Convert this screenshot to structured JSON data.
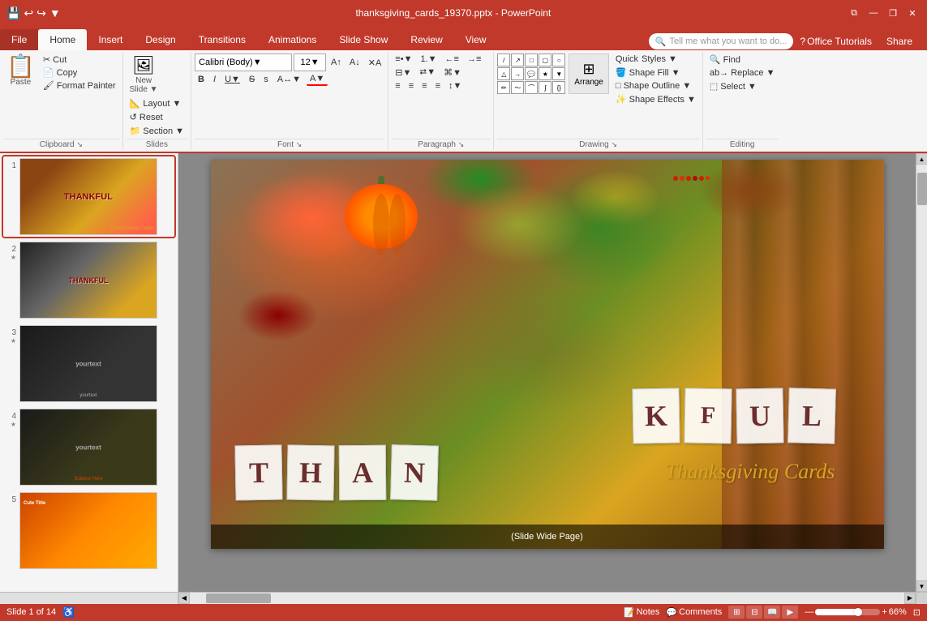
{
  "titlebar": {
    "title": "thanksgiving_cards_19370.pptx - PowerPoint",
    "save_icon": "💾",
    "undo_icon": "↩",
    "redo_icon": "↪",
    "customize_icon": "⚙",
    "minimize": "—",
    "restore": "❐",
    "close": "✕"
  },
  "tabs": [
    {
      "label": "File",
      "id": "file"
    },
    {
      "label": "Home",
      "id": "home",
      "active": true
    },
    {
      "label": "Insert",
      "id": "insert"
    },
    {
      "label": "Design",
      "id": "design"
    },
    {
      "label": "Transitions",
      "id": "transitions"
    },
    {
      "label": "Animations",
      "id": "animations"
    },
    {
      "label": "Slide Show",
      "id": "slideshow"
    },
    {
      "label": "Review",
      "id": "review"
    },
    {
      "label": "View",
      "id": "view"
    }
  ],
  "ribbon": {
    "search_placeholder": "Tell me what you want to do...",
    "groups": {
      "clipboard": {
        "label": "Clipboard",
        "paste": "Paste",
        "cut": "Cut",
        "copy": "Copy",
        "format_painter": "Format Painter"
      },
      "slides": {
        "label": "Slides",
        "new_slide": "New Slide",
        "layout": "Layout",
        "reset": "Reset",
        "section": "Section"
      },
      "font": {
        "label": "Font",
        "name": "Calibri (Body)",
        "size": "12",
        "bold": "B",
        "italic": "I",
        "underline": "U",
        "strikethrough": "S",
        "shadow": "s",
        "char_spacing": "A",
        "font_color": "A"
      },
      "paragraph": {
        "label": "Paragraph"
      },
      "drawing": {
        "label": "Drawing",
        "arrange": "Arrange",
        "quick_styles": "Quick Styles",
        "shape_fill": "Shape Fill",
        "shape_outline": "Shape Outline",
        "shape_effects": "Shape Effects"
      },
      "editing": {
        "label": "Editing",
        "find": "Find",
        "replace": "Replace",
        "select": "Select"
      }
    }
  },
  "office_tutorials": "Office Tutorials",
  "share": "Share",
  "slides": [
    {
      "num": "1",
      "star": false,
      "bg": "autumn",
      "has_thankful": true
    },
    {
      "num": "2",
      "star": true,
      "bg": "dark_yellow"
    },
    {
      "num": "3",
      "star": true,
      "bg": "dark"
    },
    {
      "num": "4",
      "star": true,
      "bg": "dark2"
    },
    {
      "num": "5",
      "star": false,
      "bg": "orange"
    }
  ],
  "main_slide": {
    "thankful_letters": [
      "T",
      "H",
      "A",
      "N",
      "K",
      "F",
      "U",
      "L"
    ],
    "subtitle": "Thanksgiving Cards",
    "footer_text": "(Slide Wide Page)"
  },
  "statusbar": {
    "slide_info": "Slide 1 of 14",
    "notes": "Notes",
    "comments": "Comments",
    "zoom": "66%",
    "zoom_value": 66
  }
}
